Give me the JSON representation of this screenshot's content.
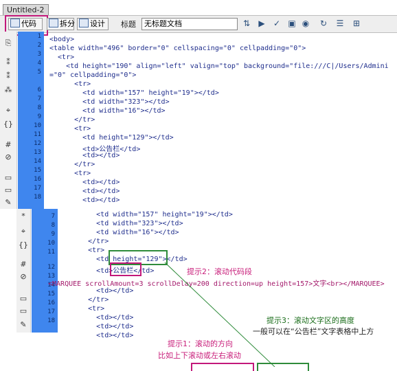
{
  "document_tab": "Untitled-2",
  "toolbar": {
    "code_label": "代码",
    "split_label": "拆分",
    "design_label": "设计",
    "title_label": "标题",
    "title_value": "无标题文档"
  },
  "line_numbers_top": [
    "1",
    "2",
    "3",
    "4",
    "5",
    "6",
    "7",
    "8",
    "9",
    "10",
    "11",
    "12",
    "13",
    "14",
    "15",
    "16",
    "17",
    "18"
  ],
  "line_numbers_bottom": [
    "7",
    "8",
    "9",
    "10",
    "11",
    "12",
    "13",
    "14",
    "15",
    "16",
    "17",
    "18"
  ],
  "code_top": [
    "<body>",
    "<table width=\"496\" border=\"0\" cellspacing=\"0\" cellpadding=\"0\">",
    "  <tr>",
    "    <td height=\"190\" align=\"left\" valign=\"top\" background=\"file:///C|/Users/Admini",
    "=\"0\" cellpadding=\"0\">",
    "      <tr>",
    "        <td width=\"157\" height=\"19\"></td>",
    "        <td width=\"323\"></td>",
    "        <td width=\"16\"></td>",
    "      </tr>",
    "      <tr>",
    "        <td height=\"129\"></td>",
    "        <td>公告栏</td>",
    "        <td></td>",
    "      </tr>",
    "      <tr>",
    "        <td></td>",
    "        <td></td>",
    "        <td></td>"
  ],
  "code_bottom": [
    "        <td width=\"157\" height=\"19\"></td>",
    "        <td width=\"323\"></td>",
    "        <td width=\"16\"></td>",
    "      </tr>",
    "      <tr>",
    "        <td height=\"129\"></td>",
    "        <td>公告栏</td>",
    "        <td></td>",
    "      </tr>",
    "      <tr>",
    "        <td></td>",
    "        <td></td>",
    "        <td></td>"
  ],
  "marquee_line": "<MARQUEE scrollAmount=3 scrollDelay=200 direction=up height=157>文字<br></MARQUEE>",
  "annotations": {
    "hint2_title": "提示2：滚动代码段",
    "hint3_title": "提示3：滚动文字区的高度",
    "hint3_body": "一般可以在“公告栏”文字表格中上方",
    "hint1_title": "提示1：滚动的方向",
    "hint1_body": "比如上下滚动或左右滚动"
  },
  "colors": {
    "gutter": "#3f86ee",
    "code_text": "#1e2d8c",
    "red_highlight": "#c2187a",
    "green_highlight": "#2e8b3a"
  }
}
